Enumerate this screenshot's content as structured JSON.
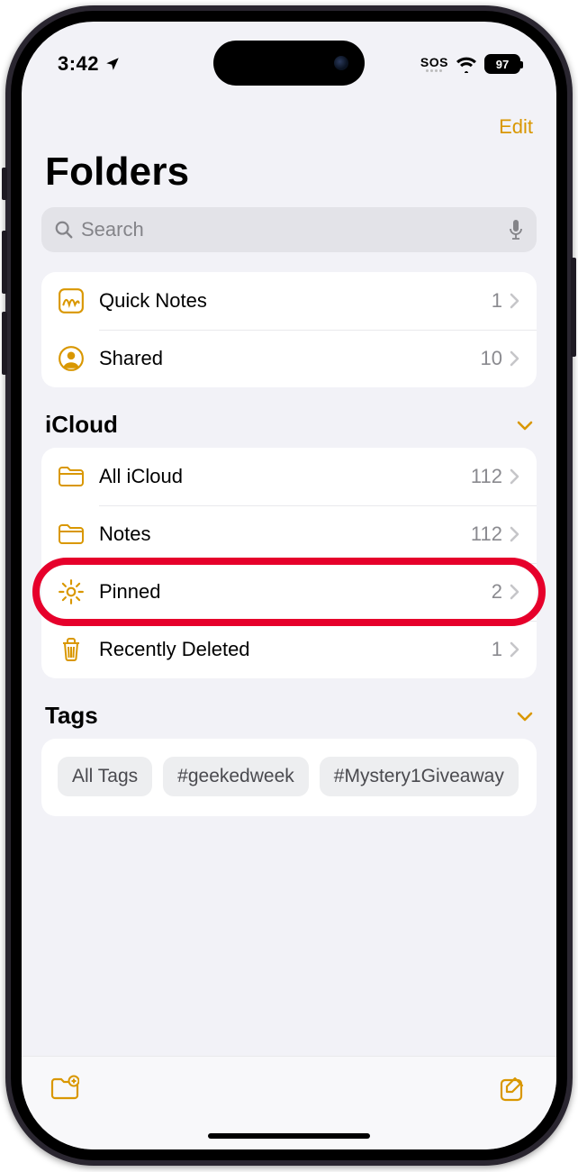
{
  "statusbar": {
    "time": "3:42",
    "sos": "SOS",
    "battery": "97"
  },
  "navbar": {
    "edit": "Edit"
  },
  "page": {
    "title": "Folders"
  },
  "search": {
    "placeholder": "Search"
  },
  "top_folders": [
    {
      "icon": "quicknote",
      "label": "Quick Notes",
      "count": "1"
    },
    {
      "icon": "shared",
      "label": "Shared",
      "count": "10"
    }
  ],
  "sections": {
    "icloud": {
      "title": "iCloud",
      "items": [
        {
          "icon": "folder",
          "label": "All iCloud",
          "count": "112"
        },
        {
          "icon": "folder",
          "label": "Notes",
          "count": "112"
        },
        {
          "icon": "gear",
          "label": "Pinned",
          "count": "2",
          "highlight": true
        },
        {
          "icon": "trash",
          "label": "Recently Deleted",
          "count": "1"
        }
      ]
    },
    "tags": {
      "title": "Tags",
      "items": [
        "All Tags",
        "#geekedweek",
        "#Mystery1Giveaway"
      ]
    }
  }
}
